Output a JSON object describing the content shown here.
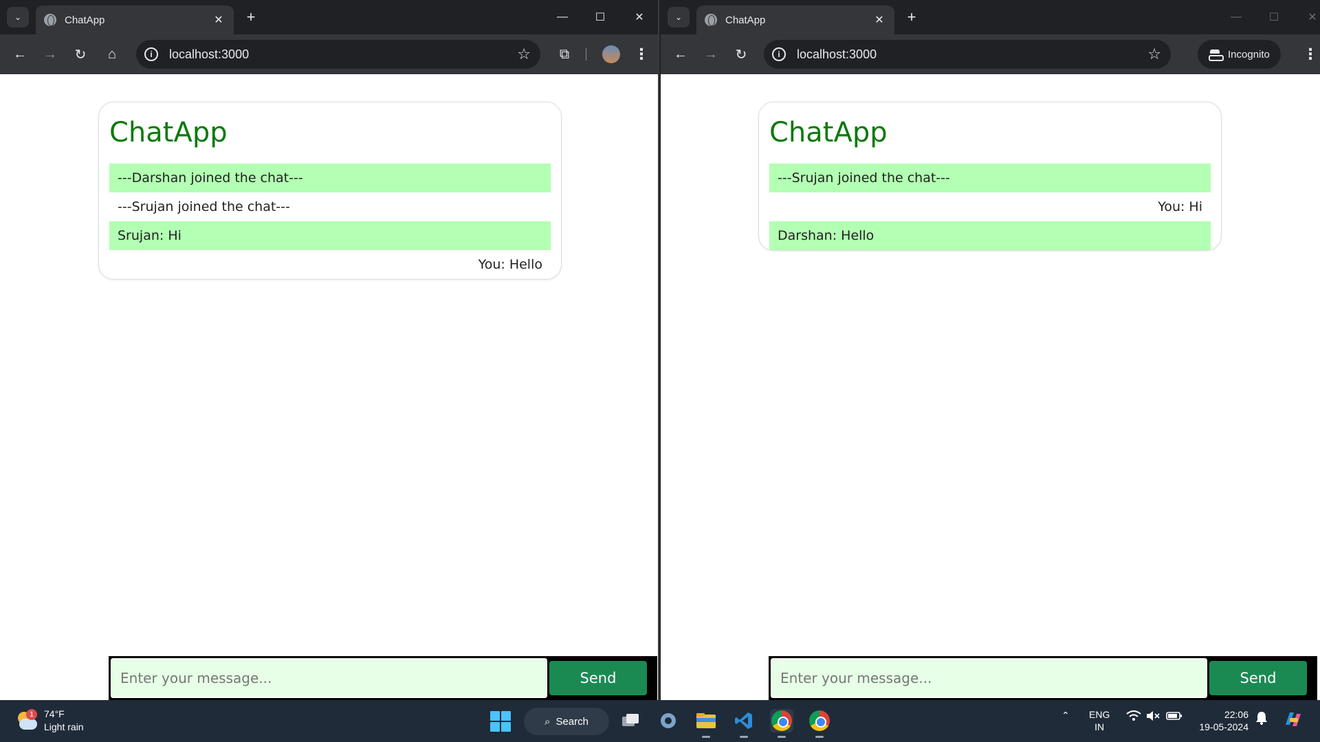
{
  "browser_left": {
    "tab_title": "ChatApp",
    "url": "localhost:3000",
    "chat": {
      "title": "ChatApp",
      "messages": [
        {
          "text": "---Darshan joined the chat---",
          "style": "green"
        },
        {
          "text": "---Srujan joined the chat---",
          "style": "plain"
        },
        {
          "text": "Srujan: Hi",
          "style": "green"
        },
        {
          "text": "You: Hello",
          "style": "right"
        }
      ],
      "input_placeholder": "Enter your message...",
      "send_label": "Send"
    }
  },
  "browser_right": {
    "tab_title": "ChatApp",
    "url": "localhost:3000",
    "incognito_label": "Incognito",
    "chat": {
      "title": "ChatApp",
      "messages": [
        {
          "text": "---Srujan joined the chat---",
          "style": "green"
        },
        {
          "text": "You: Hi",
          "style": "right"
        },
        {
          "text": "Darshan: Hello",
          "style": "green"
        }
      ],
      "input_placeholder": "Enter your message...",
      "send_label": "Send"
    }
  },
  "taskbar": {
    "weather": {
      "temp": "74°F",
      "condition": "Light rain",
      "badge": "1"
    },
    "search_label": "Search",
    "lang_line1": "ENG",
    "lang_line2": "IN",
    "time": "22:06",
    "date": "19-05-2024"
  },
  "colors": {
    "chat_title": "#0c7a0c",
    "message_highlight": "#b3ffb3",
    "input_bg": "#e6ffe6",
    "send_button": "#1a8a52"
  }
}
